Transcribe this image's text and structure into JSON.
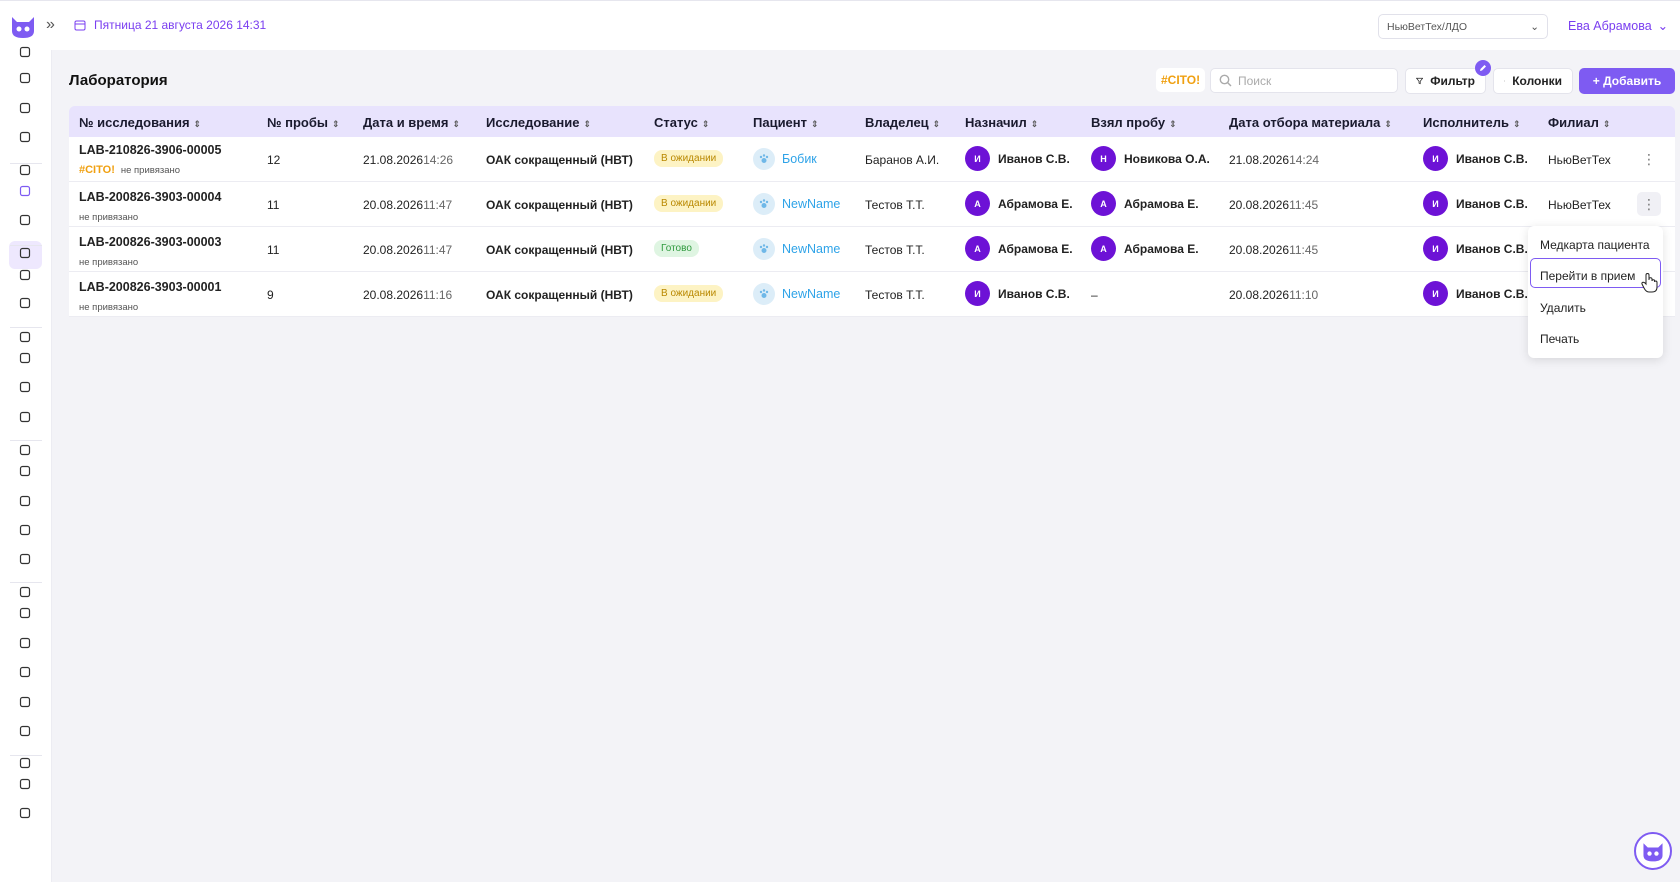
{
  "header": {
    "date": "Пятница 21 августа 2026 14:31",
    "branch": "НьюВетТех/ЛДО",
    "user": "Ева Абрамова"
  },
  "page": {
    "title": "Лаборатория",
    "cito": "#CITO!",
    "search_placeholder": "Поиск",
    "filter": "Фильтр",
    "columns": "Колонки",
    "add": "+ Добавить"
  },
  "table": {
    "headers": [
      "№ исследования",
      "№ пробы",
      "Дата и время",
      "Исследование",
      "Статус",
      "Пациент",
      "Владелец",
      "Назначил",
      "Взял пробу",
      "Дата отбора материала",
      "Исполнитель",
      "Филиал"
    ],
    "rows": [
      {
        "id": "LAB-210826-3906-00005",
        "cito": "#CITO!",
        "sub": "не привязано",
        "sample": "12",
        "date": "21.08.2026",
        "time": "14:26",
        "test": "ОАК сокращенный (НВТ)",
        "status": "В ожидании",
        "patient": "Бобик",
        "owner": "Баранов А.И.",
        "assigned_initial": "И",
        "assigned": "Иванов С.В.",
        "taker_initial": "Н",
        "taker": "Новикова О.А.",
        "mdate": "21.08.2026",
        "mtime": "14:24",
        "exec_initial": "И",
        "exec": "Иванов С.В.",
        "branch": "НьюВетТех"
      },
      {
        "id": "LAB-200826-3903-00004",
        "cito": "",
        "sub": "не привязано",
        "sample": "11",
        "date": "20.08.2026",
        "time": "11:47",
        "test": "ОАК сокращенный (НВТ)",
        "status": "В ожидании",
        "patient": "NewName",
        "owner": "Тестов Т.Т.",
        "assigned_initial": "А",
        "assigned": "Абрамова Е.",
        "taker_initial": "А",
        "taker": "Абрамова Е.",
        "mdate": "20.08.2026",
        "mtime": "11:45",
        "exec_initial": "И",
        "exec": "Иванов С.В.",
        "branch": "НьюВетТех"
      },
      {
        "id": "LAB-200826-3903-00003",
        "cito": "",
        "sub": "не привязано",
        "sample": "11",
        "date": "20.08.2026",
        "time": "11:47",
        "test": "ОАК сокращенный (НВТ)",
        "status": "Готово",
        "patient": "NewName",
        "owner": "Тестов Т.Т.",
        "assigned_initial": "А",
        "assigned": "Абрамова Е.",
        "taker_initial": "А",
        "taker": "Абрамова Е.",
        "mdate": "20.08.2026",
        "mtime": "11:45",
        "exec_initial": "И",
        "exec": "Иванов С.В.",
        "branch": ""
      },
      {
        "id": "LAB-200826-3903-00001",
        "cito": "",
        "sub": "не привязано",
        "sample": "9",
        "date": "20.08.2026",
        "time": "11:16",
        "test": "ОАК сокращенный (НВТ)",
        "status": "В ожидании",
        "patient": "NewName",
        "owner": "Тестов Т.Т.",
        "assigned_initial": "И",
        "assigned": "Иванов С.В.",
        "taker_initial": "",
        "taker": "–",
        "mdate": "20.08.2026",
        "mtime": "11:10",
        "exec_initial": "И",
        "exec": "Иванов С.В.",
        "branch": ""
      }
    ]
  },
  "context_menu": {
    "items": [
      "Медкарта пациента",
      "Перейти в прием",
      "Удалить",
      "Печать"
    ],
    "selected": "Перейти в прием"
  },
  "colors": {
    "accent": "#7e5bf2",
    "header_bg": "#e8e3fd",
    "cito": "#f0a010",
    "avatar": "#6d12d6"
  }
}
